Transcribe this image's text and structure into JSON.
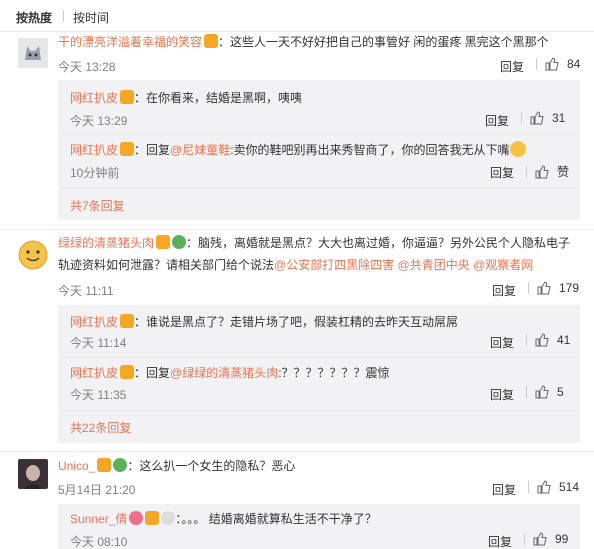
{
  "sort": {
    "hot": "按热度",
    "time": "按时间"
  },
  "comments": [
    {
      "name": "干的漂亮洋溢着幸福的笑容",
      "text": "：这些人一天不好好把自己的事管好 闲的蛋疼 黑完这个黑那个",
      "time": "今天 13:28",
      "reply": "回复",
      "likes": "84"
    },
    {
      "name": "绿绿的清蒸猪头肉",
      "text1": "：脑残，离婚就是黑点？大大也离过婚，你逼逼？另外公民个人隐私电子",
      "text2": "轨迹资料如何泄露？请相关部门给个说法",
      "mentions": [
        "@公安部打四黑除四害",
        "@共青团中央",
        "@观察者网"
      ],
      "time": "今天 11:11",
      "reply": "回复",
      "likes": "179"
    },
    {
      "name": "Unico_",
      "text": "：这么扒一个女生的隐私？恶心",
      "time": "5月14日 21:20",
      "reply": "回复",
      "likes": "514"
    }
  ],
  "subs1": [
    {
      "name": "网红扒皮",
      "text": "：在你看来，结婚是黑啊，咦咦",
      "time": "今天 13:29",
      "reply": "回复",
      "likes": "31"
    },
    {
      "name": "网红扒皮",
      "text_pre": "：回复",
      "mention": "@尼妹童鞋",
      "text_post": ":卖你的鞋吧别再出来秀智商了，你的回答我无从下嘴",
      "time": "10分钟前",
      "reply": "回复",
      "likes": "赞"
    }
  ],
  "more1": "共7条回复",
  "subs2": [
    {
      "name": "网红扒皮",
      "text": "：谁说是黑点了？走错片场了吧，假装杠精的去昨天互动屌屌",
      "time": "今天 11:14",
      "reply": "回复",
      "likes": "41"
    },
    {
      "name": "网红扒皮",
      "text_pre": "：回复",
      "mention": "@绿绿的清蒸猪头肉",
      "text_post": ":？？？？？？？震惊",
      "time": "今天 11:35",
      "reply": "回复",
      "likes": "5"
    }
  ],
  "more2": "共22条回复",
  "subs3": [
    {
      "name": "Sunner_倩",
      "text": "：。。。 结婚离婚就算私生活不干净了？",
      "time": "今天 08:10",
      "reply": "回复",
      "likes": "99"
    }
  ],
  "colors": {
    "accent": "#eb7350",
    "sub_bg": "#f2f2f5"
  }
}
